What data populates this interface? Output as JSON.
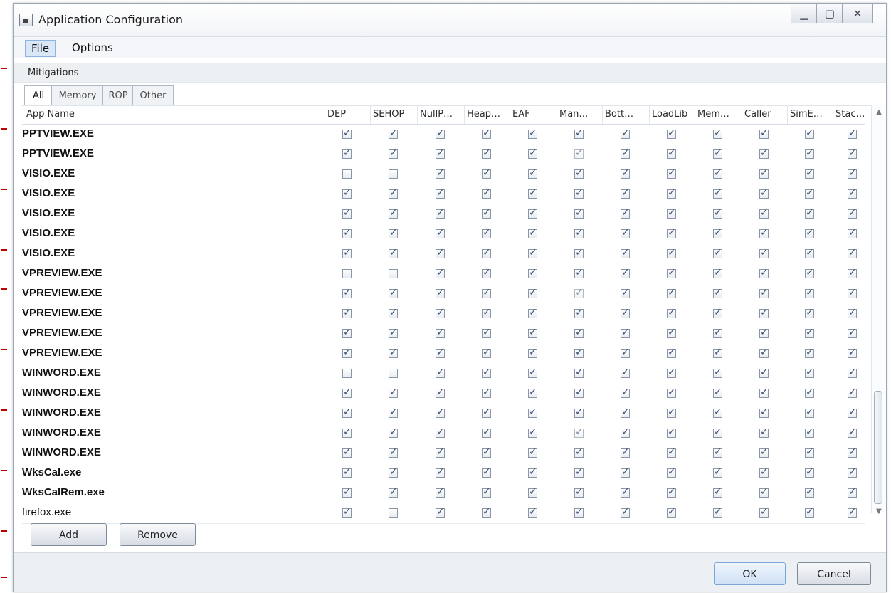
{
  "window": {
    "title": "Application Configuration"
  },
  "menu": {
    "items": [
      "File",
      "Options"
    ]
  },
  "section": {
    "label": "Mitigations"
  },
  "tabs": [
    "All",
    "Memory",
    "ROP",
    "Other"
  ],
  "grid": {
    "columns": [
      "App Name",
      "DEP",
      "SEHOP",
      "NullP…",
      "Heap…",
      "EAF",
      "Man…",
      "Bott…",
      "LoadLib",
      "Mem…",
      "Caller",
      "SimE…",
      "Stac…"
    ],
    "rows": [
      {
        "name": "PPTVIEW.EXE",
        "bold": true,
        "checks": [
          true,
          true,
          true,
          true,
          true,
          true,
          true,
          true,
          true,
          true,
          true,
          true
        ]
      },
      {
        "name": "PPTVIEW.EXE",
        "bold": true,
        "checks": [
          true,
          true,
          true,
          true,
          true,
          true,
          true,
          true,
          true,
          true,
          true,
          true
        ]
      },
      {
        "name": "VISIO.EXE",
        "bold": true,
        "checks": [
          false,
          false,
          true,
          true,
          true,
          true,
          true,
          true,
          true,
          true,
          true,
          true
        ]
      },
      {
        "name": "VISIO.EXE",
        "bold": true,
        "checks": [
          true,
          true,
          true,
          true,
          true,
          true,
          true,
          true,
          true,
          true,
          true,
          true
        ]
      },
      {
        "name": "VISIO.EXE",
        "bold": true,
        "checks": [
          true,
          true,
          true,
          true,
          true,
          true,
          true,
          true,
          true,
          true,
          true,
          true
        ]
      },
      {
        "name": "VISIO.EXE",
        "bold": true,
        "checks": [
          true,
          true,
          true,
          true,
          true,
          true,
          true,
          true,
          true,
          true,
          true,
          true
        ]
      },
      {
        "name": "VISIO.EXE",
        "bold": true,
        "checks": [
          true,
          true,
          true,
          true,
          true,
          true,
          true,
          true,
          true,
          true,
          true,
          true
        ]
      },
      {
        "name": "VPREVIEW.EXE",
        "bold": true,
        "checks": [
          false,
          false,
          true,
          true,
          true,
          true,
          true,
          true,
          true,
          true,
          true,
          true
        ]
      },
      {
        "name": "VPREVIEW.EXE",
        "bold": true,
        "checks": [
          true,
          true,
          true,
          true,
          true,
          true,
          true,
          true,
          true,
          true,
          true,
          true
        ]
      },
      {
        "name": "VPREVIEW.EXE",
        "bold": true,
        "checks": [
          true,
          true,
          true,
          true,
          true,
          true,
          true,
          true,
          true,
          true,
          true,
          true
        ]
      },
      {
        "name": "VPREVIEW.EXE",
        "bold": true,
        "checks": [
          true,
          true,
          true,
          true,
          true,
          true,
          true,
          true,
          true,
          true,
          true,
          true
        ]
      },
      {
        "name": "VPREVIEW.EXE",
        "bold": true,
        "checks": [
          true,
          true,
          true,
          true,
          true,
          true,
          true,
          true,
          true,
          true,
          true,
          true
        ]
      },
      {
        "name": "WINWORD.EXE",
        "bold": true,
        "checks": [
          false,
          false,
          true,
          true,
          true,
          true,
          true,
          true,
          true,
          true,
          true,
          true
        ]
      },
      {
        "name": "WINWORD.EXE",
        "bold": true,
        "checks": [
          true,
          true,
          true,
          true,
          true,
          true,
          true,
          true,
          true,
          true,
          true,
          true
        ]
      },
      {
        "name": "WINWORD.EXE",
        "bold": true,
        "checks": [
          true,
          true,
          true,
          true,
          true,
          true,
          true,
          true,
          true,
          true,
          true,
          true
        ]
      },
      {
        "name": "WINWORD.EXE",
        "bold": true,
        "checks": [
          true,
          true,
          true,
          true,
          true,
          true,
          true,
          true,
          true,
          true,
          true,
          true
        ]
      },
      {
        "name": "WINWORD.EXE",
        "bold": true,
        "checks": [
          true,
          true,
          true,
          true,
          true,
          true,
          true,
          true,
          true,
          true,
          true,
          true
        ]
      },
      {
        "name": "WksCal.exe",
        "bold": true,
        "checks": [
          true,
          true,
          true,
          true,
          true,
          true,
          true,
          true,
          true,
          true,
          true,
          true
        ]
      },
      {
        "name": "WksCalRem.exe",
        "bold": true,
        "checks": [
          true,
          true,
          true,
          true,
          true,
          true,
          true,
          true,
          true,
          true,
          true,
          true
        ]
      },
      {
        "name": "firefox.exe",
        "bold": false,
        "checks": [
          true,
          false,
          true,
          true,
          true,
          true,
          true,
          true,
          true,
          true,
          true,
          true
        ]
      }
    ]
  },
  "buttons": {
    "add": "Add",
    "remove": "Remove",
    "ok": "OK",
    "cancel": "Cancel"
  }
}
